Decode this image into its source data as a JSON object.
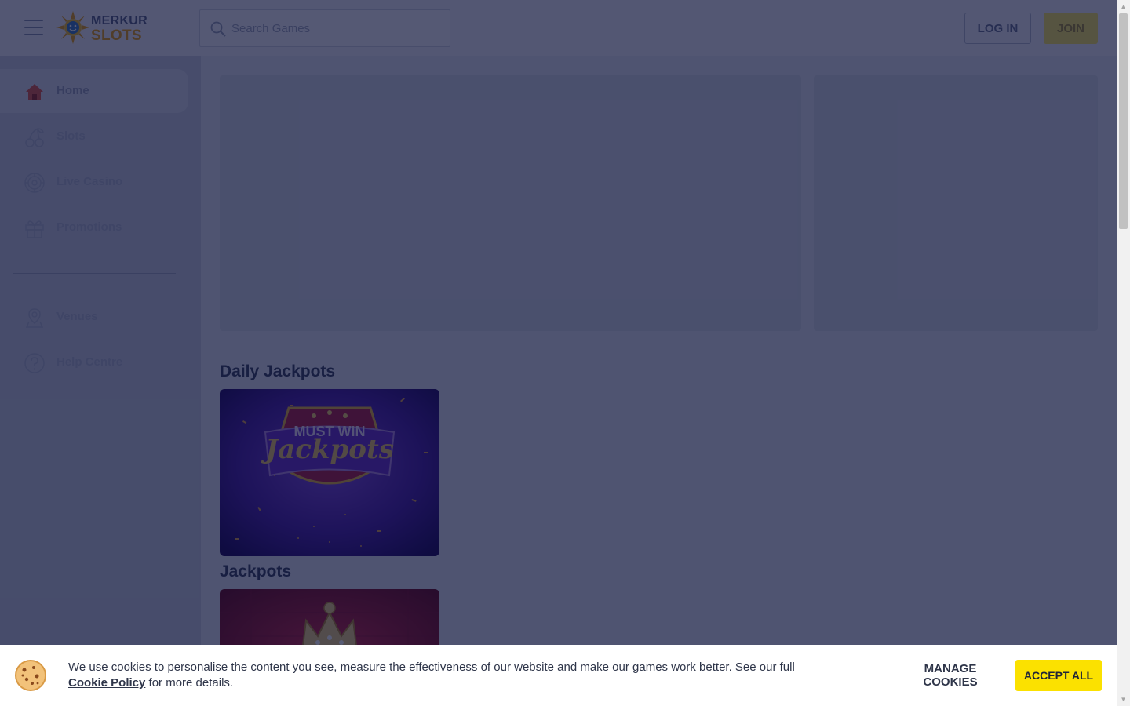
{
  "header": {
    "logo_line1": "MERKUR",
    "logo_line2": "SLOTS",
    "search_placeholder": "Search Games",
    "login_label": "LOG IN",
    "join_label": "JOIN"
  },
  "sidebar": {
    "items": [
      {
        "label": "Home",
        "icon": "home-icon",
        "active": true
      },
      {
        "label": "Slots",
        "icon": "cherries-icon"
      },
      {
        "label": "Live Casino",
        "icon": "roulette-icon"
      },
      {
        "label": "Promotions",
        "icon": "gift-icon"
      },
      {
        "label": "Venues",
        "icon": "map-pin-icon"
      },
      {
        "label": "Help Centre",
        "icon": "question-circle-icon"
      }
    ]
  },
  "main": {
    "sections": [
      {
        "title": "Daily Jackpots",
        "tiles": [
          {
            "line1": "MUST WIN",
            "line2": "Jackpots"
          }
        ]
      },
      {
        "title": "Jackpots"
      }
    ]
  },
  "cookie_banner": {
    "text": "We use cookies to personalise the content you see, measure the effectiveness of our website and make our games work better. See our full",
    "link_label": "Cookie Policy",
    "text_after": "for more details.",
    "manage_label": "MANAGE COOKIES",
    "accept_label": "ACCEPT ALL"
  },
  "colors": {
    "accent_yellow": "#fbe100",
    "overlay": "#080e34",
    "sidebar_bg": "#cdd1e0"
  }
}
